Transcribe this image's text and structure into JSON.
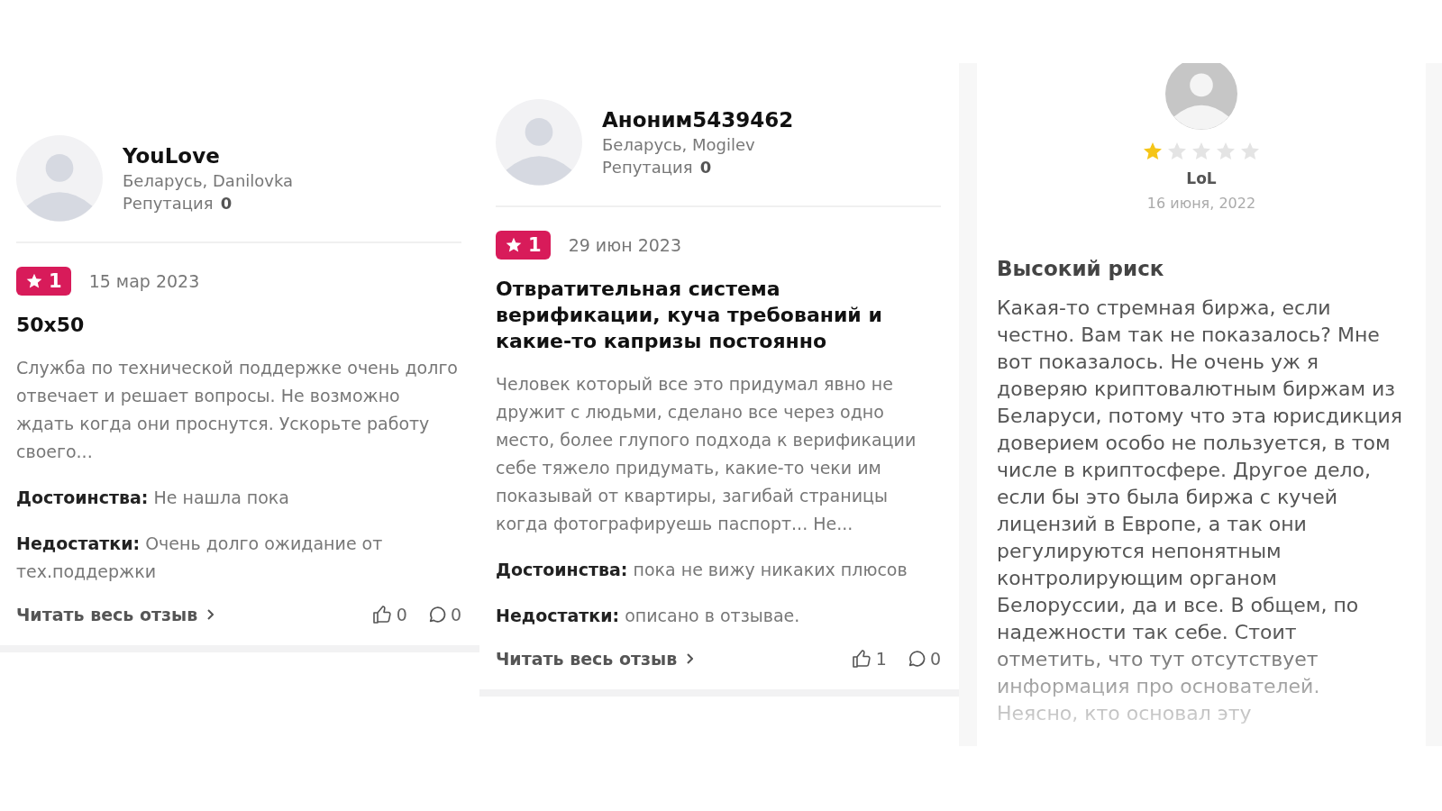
{
  "reviews": [
    {
      "kind": "card",
      "author": "YouLove",
      "location": "Беларусь, Danilovka",
      "reputation_label": "Репутация",
      "reputation": "0",
      "rating": "1",
      "date": "15 мар 2023",
      "title": "50x50",
      "body": "Служба по технической поддержке очень долго отвечает и решает вопросы. Не возможно ждать когда они проснутся. Ускорьте работу своего...",
      "pros_label": "Достоинства:",
      "pros": "Не нашла пока",
      "cons_label": "Недостатки:",
      "cons": "Очень долго ожидание от тех.поддержки",
      "read_more": "Читать весь отзыв",
      "likes": "0",
      "comments": "0"
    },
    {
      "kind": "card",
      "author": "Аноним5439462",
      "location": "Беларусь, Mogilev",
      "reputation_label": "Репутация",
      "reputation": "0",
      "rating": "1",
      "date": "29 июн 2023",
      "title": "Отвратительная система верификации, куча требований и какие-то капризы постоянно",
      "body": "Человек который все это придумал явно не дружит с людьми, сделано все через одно место, более глупого подхода к верификации себе тяжело придумать, какие-то чеки им показывай от квартиры, загибай страницы когда фотографируешь паспорт... Не...",
      "pros_label": "Достоинства:",
      "pros": "пока не вижу никаких плюсов",
      "cons_label": "Недостатки:",
      "cons": "описано в отзывае.",
      "read_more": "Читать весь отзыв",
      "likes": "1",
      "comments": "0"
    },
    {
      "kind": "panel",
      "stars": 1,
      "author": "LoL",
      "date": "16 июня, 2022",
      "title": "Высокий риск",
      "body": "Какая-то стремная биржа, если честно. Вам так не показалось? Мне вот показалось. Не очень уж я доверяю криптовалютным биржам из Беларуси, потому что эта юрисдикция доверием особо не пользуется, в том числе в криптосфере. Другое дело, если бы это была биржа с кучей лицензий в Европе, а так они регулируются непонятным контролирующим органом Белоруссии, да и все. В общем, по надежности так себе. Стоит отметить, что тут отсутствует информация про основателей. Неясно, кто основал эту"
    }
  ]
}
